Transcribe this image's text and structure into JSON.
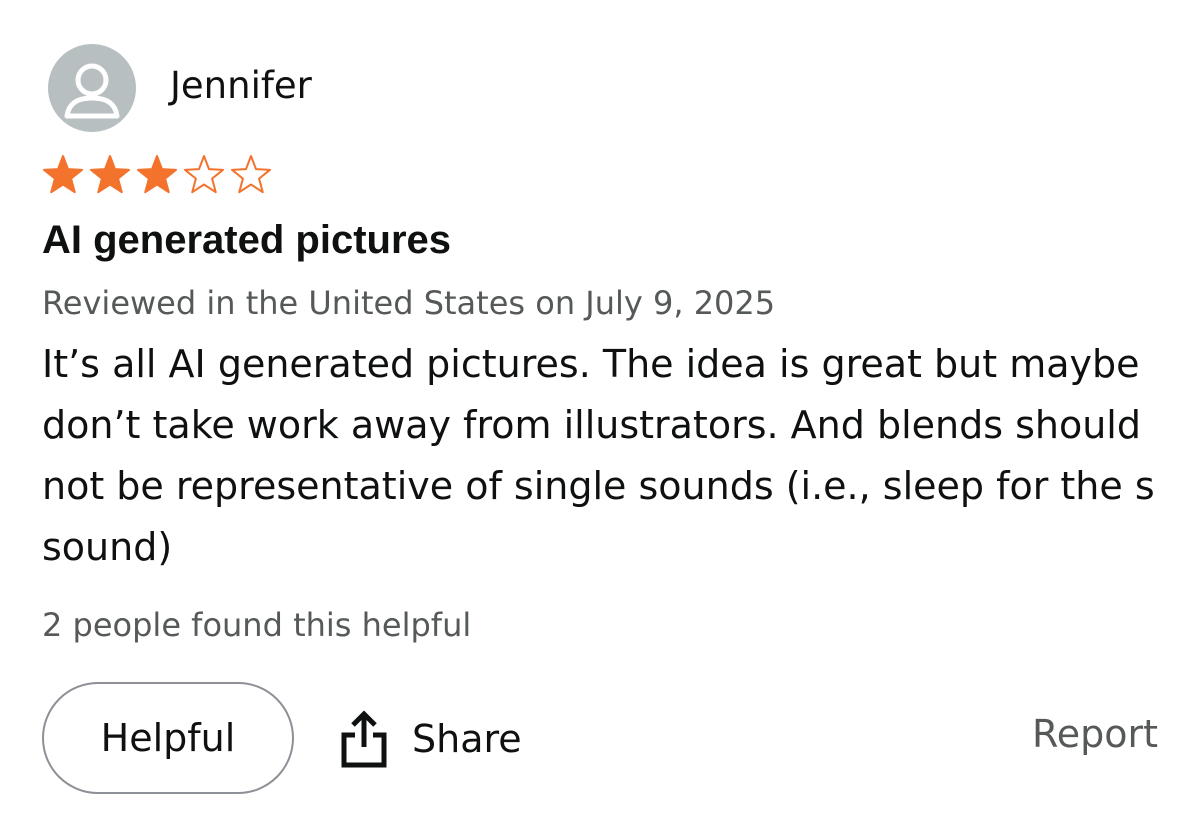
{
  "reviewer": {
    "name": "Jennifer",
    "avatar_icon": "user-silhouette-icon"
  },
  "rating": {
    "value": 3,
    "max": 5,
    "filled_color": "#f3722c",
    "star_icon": "star-icon"
  },
  "review": {
    "title": "AI generated pictures",
    "meta": "Reviewed in the United States on July 9, 2025",
    "body": "It’s all AI generated pictures. The idea is great but maybe don’t take work away from illustrators. And blends should not be representative of single sounds (i.e., sleep for the s sound)"
  },
  "helpful_count_text": "2 people found this helpful",
  "actions": {
    "helpful_label": "Helpful",
    "share_label": "Share",
    "share_icon": "share-icon",
    "report_label": "Report"
  }
}
